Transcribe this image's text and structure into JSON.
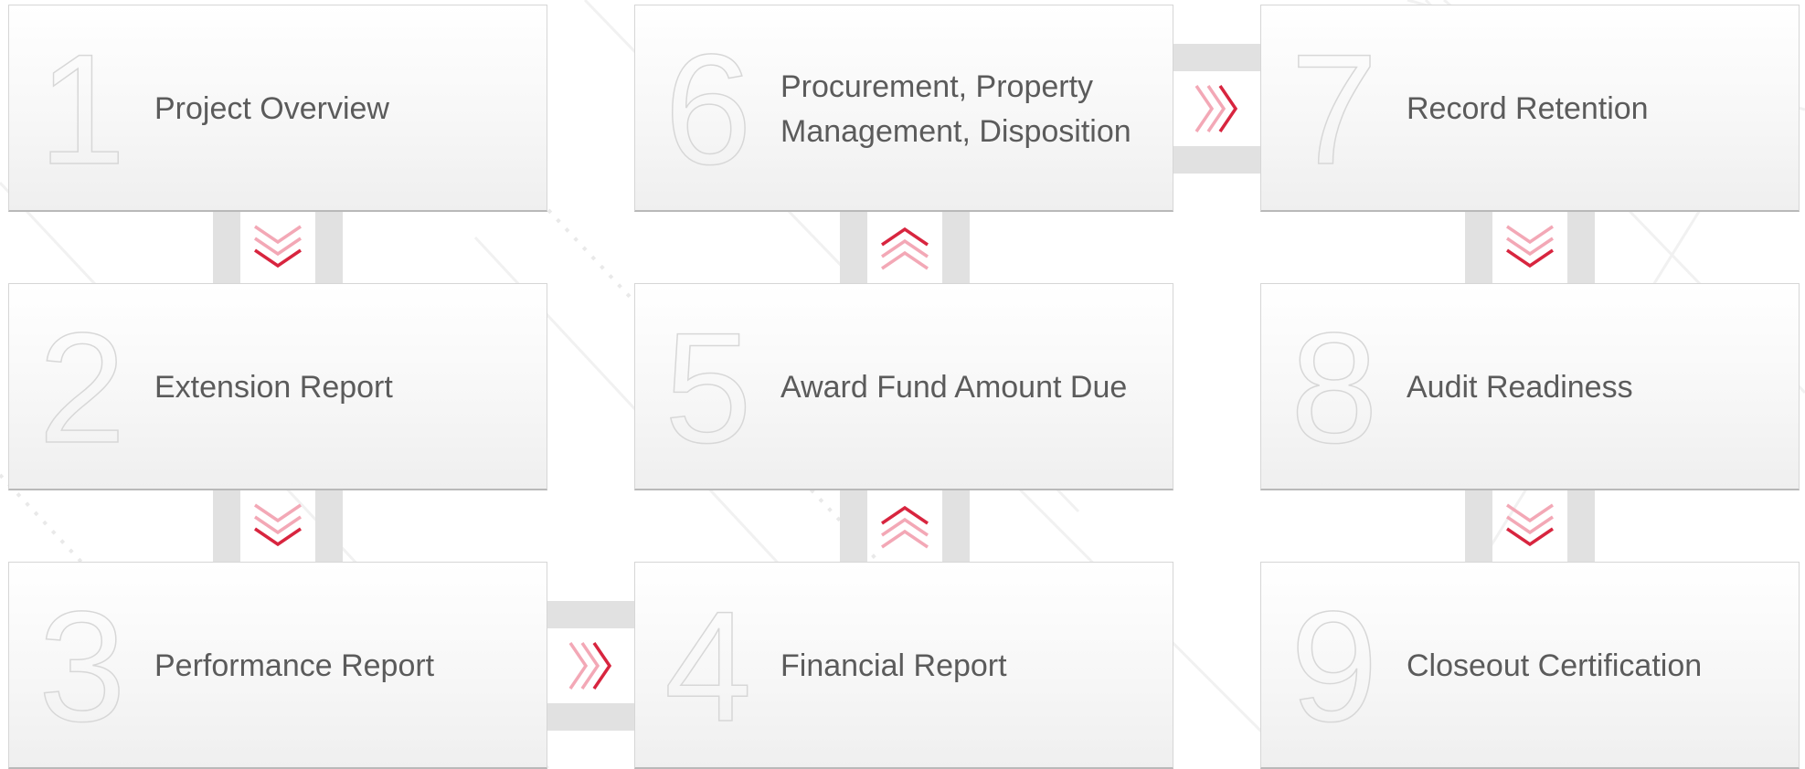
{
  "colors": {
    "accent": "#d8253f",
    "accent_light": "#f3a8b6",
    "rail": "#e1e1e1",
    "card_border": "#d6d6d6",
    "label_text": "#5b5b5b",
    "number_outline": "#d7d7d7"
  },
  "steps": [
    {
      "number": "1",
      "label": "Project Overview"
    },
    {
      "number": "2",
      "label": "Extension Report"
    },
    {
      "number": "3",
      "label": "Performance Report"
    },
    {
      "number": "4",
      "label": "Financial Report"
    },
    {
      "number": "5",
      "label": "Award Fund Amount Due"
    },
    {
      "number": "6",
      "label": "Procurement, Property Management, Disposition"
    },
    {
      "number": "7",
      "label": "Record Retention"
    },
    {
      "number": "8",
      "label": "Audit Readiness"
    },
    {
      "number": "9",
      "label": "Closeout Certification"
    }
  ],
  "connectors": [
    {
      "from": "1",
      "to": "2",
      "direction": "down",
      "icon": "chevron-double-down-icon"
    },
    {
      "from": "2",
      "to": "3",
      "direction": "down",
      "icon": "chevron-double-down-icon"
    },
    {
      "from": "3",
      "to": "4",
      "direction": "right",
      "icon": "chevron-triple-right-icon"
    },
    {
      "from": "4",
      "to": "5",
      "direction": "up",
      "icon": "chevron-double-up-icon"
    },
    {
      "from": "5",
      "to": "6",
      "direction": "up",
      "icon": "chevron-double-up-icon"
    },
    {
      "from": "6",
      "to": "7",
      "direction": "right",
      "icon": "chevron-triple-right-icon"
    },
    {
      "from": "7",
      "to": "8",
      "direction": "down",
      "icon": "chevron-double-down-icon"
    },
    {
      "from": "8",
      "to": "9",
      "direction": "down",
      "icon": "chevron-double-down-icon"
    }
  ]
}
